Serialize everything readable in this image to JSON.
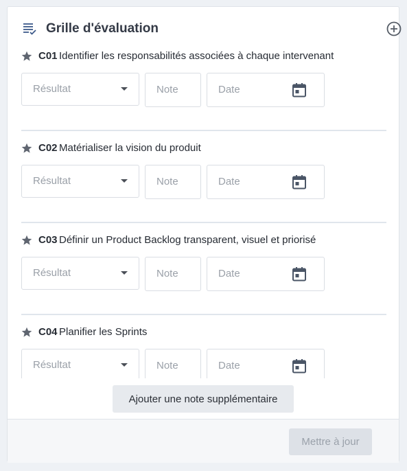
{
  "panel": {
    "title": "Grille d'évaluation",
    "icons": {
      "header": "checklist-icon",
      "add": "plus-circle-icon"
    }
  },
  "criteria": [
    {
      "code": "C01",
      "text": "Identifier les responsabilités associées à chaque intervenant",
      "result_placeholder": "Résultat",
      "note_placeholder": "Note",
      "date_placeholder": "Date"
    },
    {
      "code": "C02",
      "text": "Matérialiser la vision du produit",
      "result_placeholder": "Résultat",
      "note_placeholder": "Note",
      "date_placeholder": "Date"
    },
    {
      "code": "C03",
      "text": "Définir un Product Backlog transparent, visuel et priorisé",
      "result_placeholder": "Résultat",
      "note_placeholder": "Note",
      "date_placeholder": "Date"
    },
    {
      "code": "C04",
      "text": "Planifier les Sprints",
      "result_placeholder": "Résultat",
      "note_placeholder": "Note",
      "date_placeholder": "Date"
    }
  ],
  "actions": {
    "add_note_label": "Ajouter une note supplémentaire",
    "update_label": "Mettre à jour"
  },
  "colors": {
    "text": "#262b33",
    "placeholder": "#9aa0a8",
    "icon": "#3d4a5c",
    "button_disabled": "#dde1e7"
  }
}
